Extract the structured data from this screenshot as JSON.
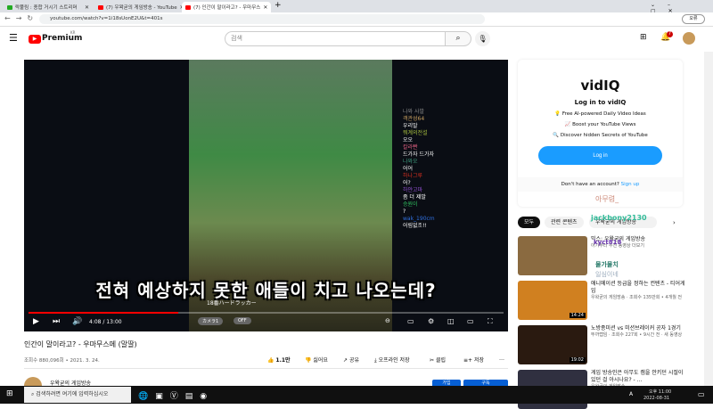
{
  "browser": {
    "tabs": [
      {
        "label": "락풀림 : 종합 거시기 스트리머"
      },
      {
        "label": "(7) 우왁굳의 게임방송 - YouTube"
      },
      {
        "label": "(7) 인간이 말이라고? - 우마무스"
      }
    ],
    "new_tab": "+",
    "url": "youtube.com/watch?v=1i18sUonE2U&t=401s",
    "profile": "오류"
  },
  "header": {
    "logo": "Premium",
    "region": "KR",
    "search_placeholder": "검색",
    "notif_count": "7"
  },
  "player": {
    "chat": [
      {
        "user": "나와 사발",
        "msg": "",
        "color": "#888888"
      },
      {
        "user": "객관성64",
        "msg": "우리말",
        "color": "#c8a060"
      },
      {
        "user": "뭐계의전설",
        "msg": "오오",
        "color": "#a8c040"
      },
      {
        "user": "칼라빤",
        "msg": "드가자 드가자",
        "color": "#e06080"
      },
      {
        "user": "나와오",
        "msg": "어어",
        "color": "#40a080"
      },
      {
        "user": "하나그루",
        "msg": "어?",
        "color": "#e03020"
      },
      {
        "user": "하얀고마",
        "msg": "좀 더 제발",
        "color": "#9050d0"
      },
      {
        "user": "승원이",
        "msg": "?",
        "color": "#30c060"
      },
      {
        "user": "wak_190cm",
        "msg": "어림없조!!",
        "color": "#3070e0"
      }
    ],
    "subtitle": "전혀 예상하지 못한 애들이 치고 나오는데?",
    "time": "4:08 / 13:00",
    "progress": 0.315,
    "overlay_line": "18番ハードラッカー",
    "camera_btn": "カメラ1",
    "auto_btn": "OFF"
  },
  "video": {
    "title": "인간이 말이라고? - 우마무스메 (말딸)",
    "views": "조회수 880,096회 • 2021. 3. 24.",
    "likes": "1.1만",
    "dislike": "싫어요",
    "share": "공유",
    "download": "오프라인 저장",
    "clip": "클립",
    "save": "저장",
    "more": "…",
    "channel": "우왁굳의 게임방송",
    "join": "가입",
    "subscribe": "구독"
  },
  "vidiq": {
    "logo": "vidIQ",
    "title": "Log in to vidIQ",
    "features": [
      "💡 Free AI-powered Daily Video Ideas",
      "📈 Boost your YouTube Views",
      "🔍 Discover hidden Secrets of YouTube"
    ],
    "login": "Log in",
    "no_account": "Don't have an account?",
    "signup": "Sign up"
  },
  "chips": [
    "모두",
    "관련 콘텐츠",
    "우왁굳의 게임방송"
  ],
  "related": [
    {
      "title": "믹스: 우왁굳의 게임방송",
      "meta": "아기부터 추천 동영상 더보기",
      "duration": ""
    },
    {
      "title": "애니메이션 등급을 정하는 컨텐츠 - 티어게임",
      "meta": "우왁굳의 게임방송 · 조회수 135만회 • 4개월 전",
      "duration": "14:24"
    },
    {
      "title": "노방종미션 vs 미션브레이커 공자 1경기",
      "meta": "뚜까랩임 · 조회수 227회 • 9시간 전 · 새 동영상",
      "duration": "19:02"
    },
    {
      "title": "게임 방송인은 아무도 캠을 안키던 시절이 있던 걸 아시나요? - ...",
      "meta": "우왁굳의 게임방송",
      "duration": ""
    }
  ],
  "overlay_names": [
    "아무렴_",
    "kyct818",
    "물가물치",
    "일심이네",
    "jackbony2130"
  ],
  "taskbar": {
    "search": "검색하려면 여기에 입력하십시오",
    "time": "오후 11:00",
    "date": "2022-08-31",
    "ime": "A"
  }
}
